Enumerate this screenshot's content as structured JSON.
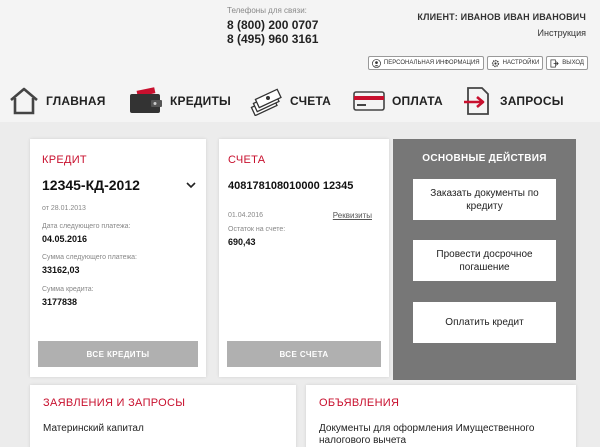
{
  "header": {
    "phones_caption": "Телефоны для связи:",
    "phone_1": "8 (800) 200 0707",
    "phone_2": "8 (495) 960 3161",
    "client_label": "КЛИЕНТ: ИВАНОВ ИВАН ИВАНОВИЧ",
    "instruction_link": "Инструкция",
    "buttons": {
      "personal_info": "ПЕРСОНАЛЬНАЯ ИНФОРМАЦИЯ",
      "settings": "НАСТРОЙКИ",
      "logout": "ВЫХОД"
    }
  },
  "nav": {
    "home": "ГЛАВНАЯ",
    "credits": "КРЕДИТЫ",
    "accounts": "СЧЕТА",
    "payment": "ОПЛАТА",
    "requests": "ЗАПРОСЫ"
  },
  "credit": {
    "title": "КРЕДИТ",
    "number": "12345-КД-2012",
    "date": "от 28.01.2013",
    "next_payment_date_label": "Дата следующего платежа:",
    "next_payment_date": "04.05.2016",
    "next_payment_sum_label": "Сумма следующего платежа:",
    "next_payment_sum": "33162,03",
    "credit_sum_label": "Сумма кредита:",
    "credit_sum": "3177838",
    "all_button": "ВСЕ КРЕДИТЫ"
  },
  "account": {
    "title": "СЧЕТА",
    "number": "408178108010000 12345",
    "date": "01.04.2016",
    "requisites_link": "Реквизиты",
    "balance_label": "Остаток на счете:",
    "balance": "690,43",
    "all_button": "ВСЕ СЧЕТА"
  },
  "actions": {
    "title": "ОСНОВНЫЕ ДЕЙСТВИЯ",
    "order_docs": "Заказать документы по кредиту",
    "early_repay": "Провести досрочное погашение",
    "pay_credit": "Оплатить кредит"
  },
  "statements": {
    "title": "ЗАЯВЛЕНИЯ И ЗАПРОСЫ",
    "item_1": "Материнский капитал"
  },
  "announcements": {
    "title": "ОБЪЯВЛЕНИЯ",
    "item_1": "Документы для оформления Имущественного налогового вычета"
  },
  "colors": {
    "accent": "#c8102e",
    "actions_bg": "#777777",
    "gray_button": "#b0b0b0"
  }
}
